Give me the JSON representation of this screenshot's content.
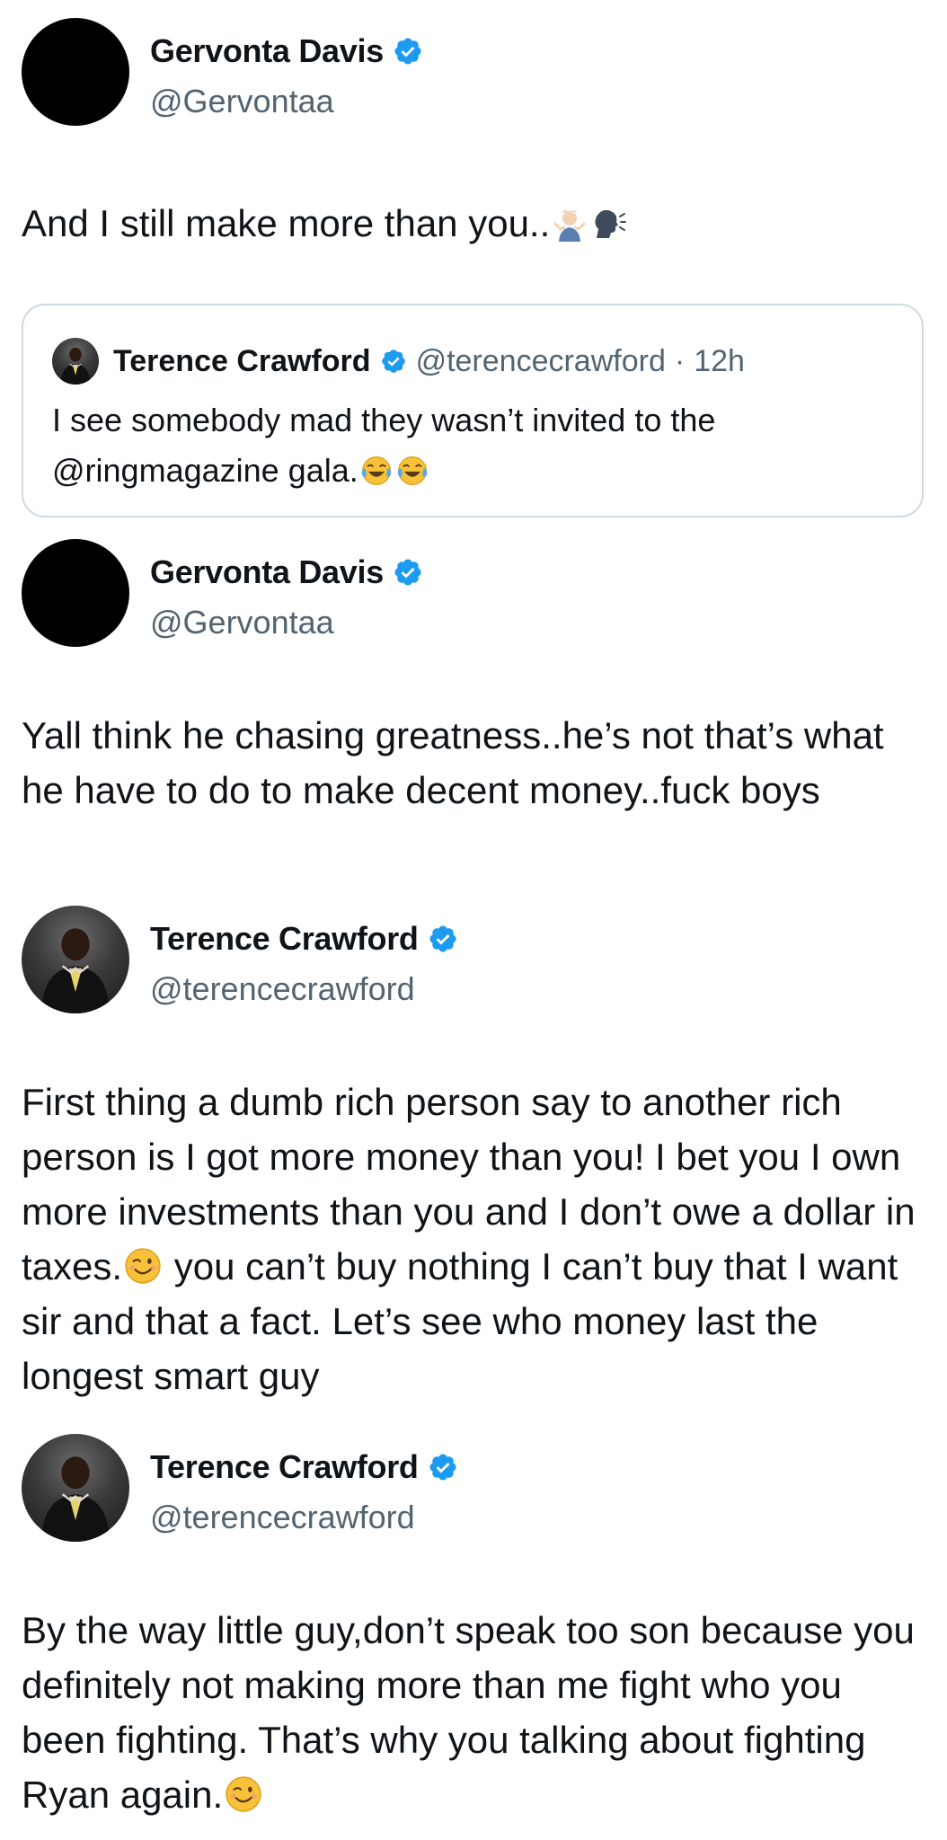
{
  "tweets": [
    {
      "author": {
        "name": "Gervonta Davis",
        "handle": "@Gervontaa",
        "verified": true,
        "avatar": "black-circle-avatar"
      },
      "text": "And I still make more than you..",
      "emojis": [
        "person-shrugging-emoji",
        "speaking-head-emoji"
      ],
      "quoted": {
        "author": {
          "name": "Terence Crawford",
          "handle": "@terencecrawford",
          "verified": true,
          "avatar": "photo-avatar"
        },
        "separator": "·",
        "time": "12h",
        "text": "I see somebody mad they wasn’t invited to the @ringmagazine gala.",
        "emojis": [
          "tears-of-joy-emoji",
          "tears-of-joy-emoji"
        ]
      }
    },
    {
      "author": {
        "name": "Gervonta Davis",
        "handle": "@Gervontaa",
        "verified": true,
        "avatar": "black-circle-avatar"
      },
      "text": "Yall think he chasing greatness..he’s not that’s what he have to do to make decent money..fuck boys"
    },
    {
      "author": {
        "name": "Terence Crawford",
        "handle": "@terencecrawford",
        "verified": true,
        "avatar": "photo-avatar"
      },
      "text_before_emoji": "First thing a dumb rich person say to another rich person is I got more money than you! I bet you I own more investments than you and I don’t owe a dollar in taxes.",
      "emoji": "winking-face-emoji",
      "text_after_emoji": " you can’t buy nothing I can’t buy that I want sir and that a fact. Let’s see who money last the longest smart guy"
    },
    {
      "author": {
        "name": "Terence Crawford",
        "handle": "@terencecrawford",
        "verified": true,
        "avatar": "photo-avatar"
      },
      "text": "By the way little guy,don’t speak too son because you definitely not making more than me fight who you been fighting. That’s why you talking about fighting Ryan again.",
      "emoji": "winking-face-emoji"
    }
  ],
  "colors": {
    "text": "#0f1419",
    "secondary": "#536471",
    "verified": "#1d9bf0",
    "border": "#cfd9de"
  }
}
